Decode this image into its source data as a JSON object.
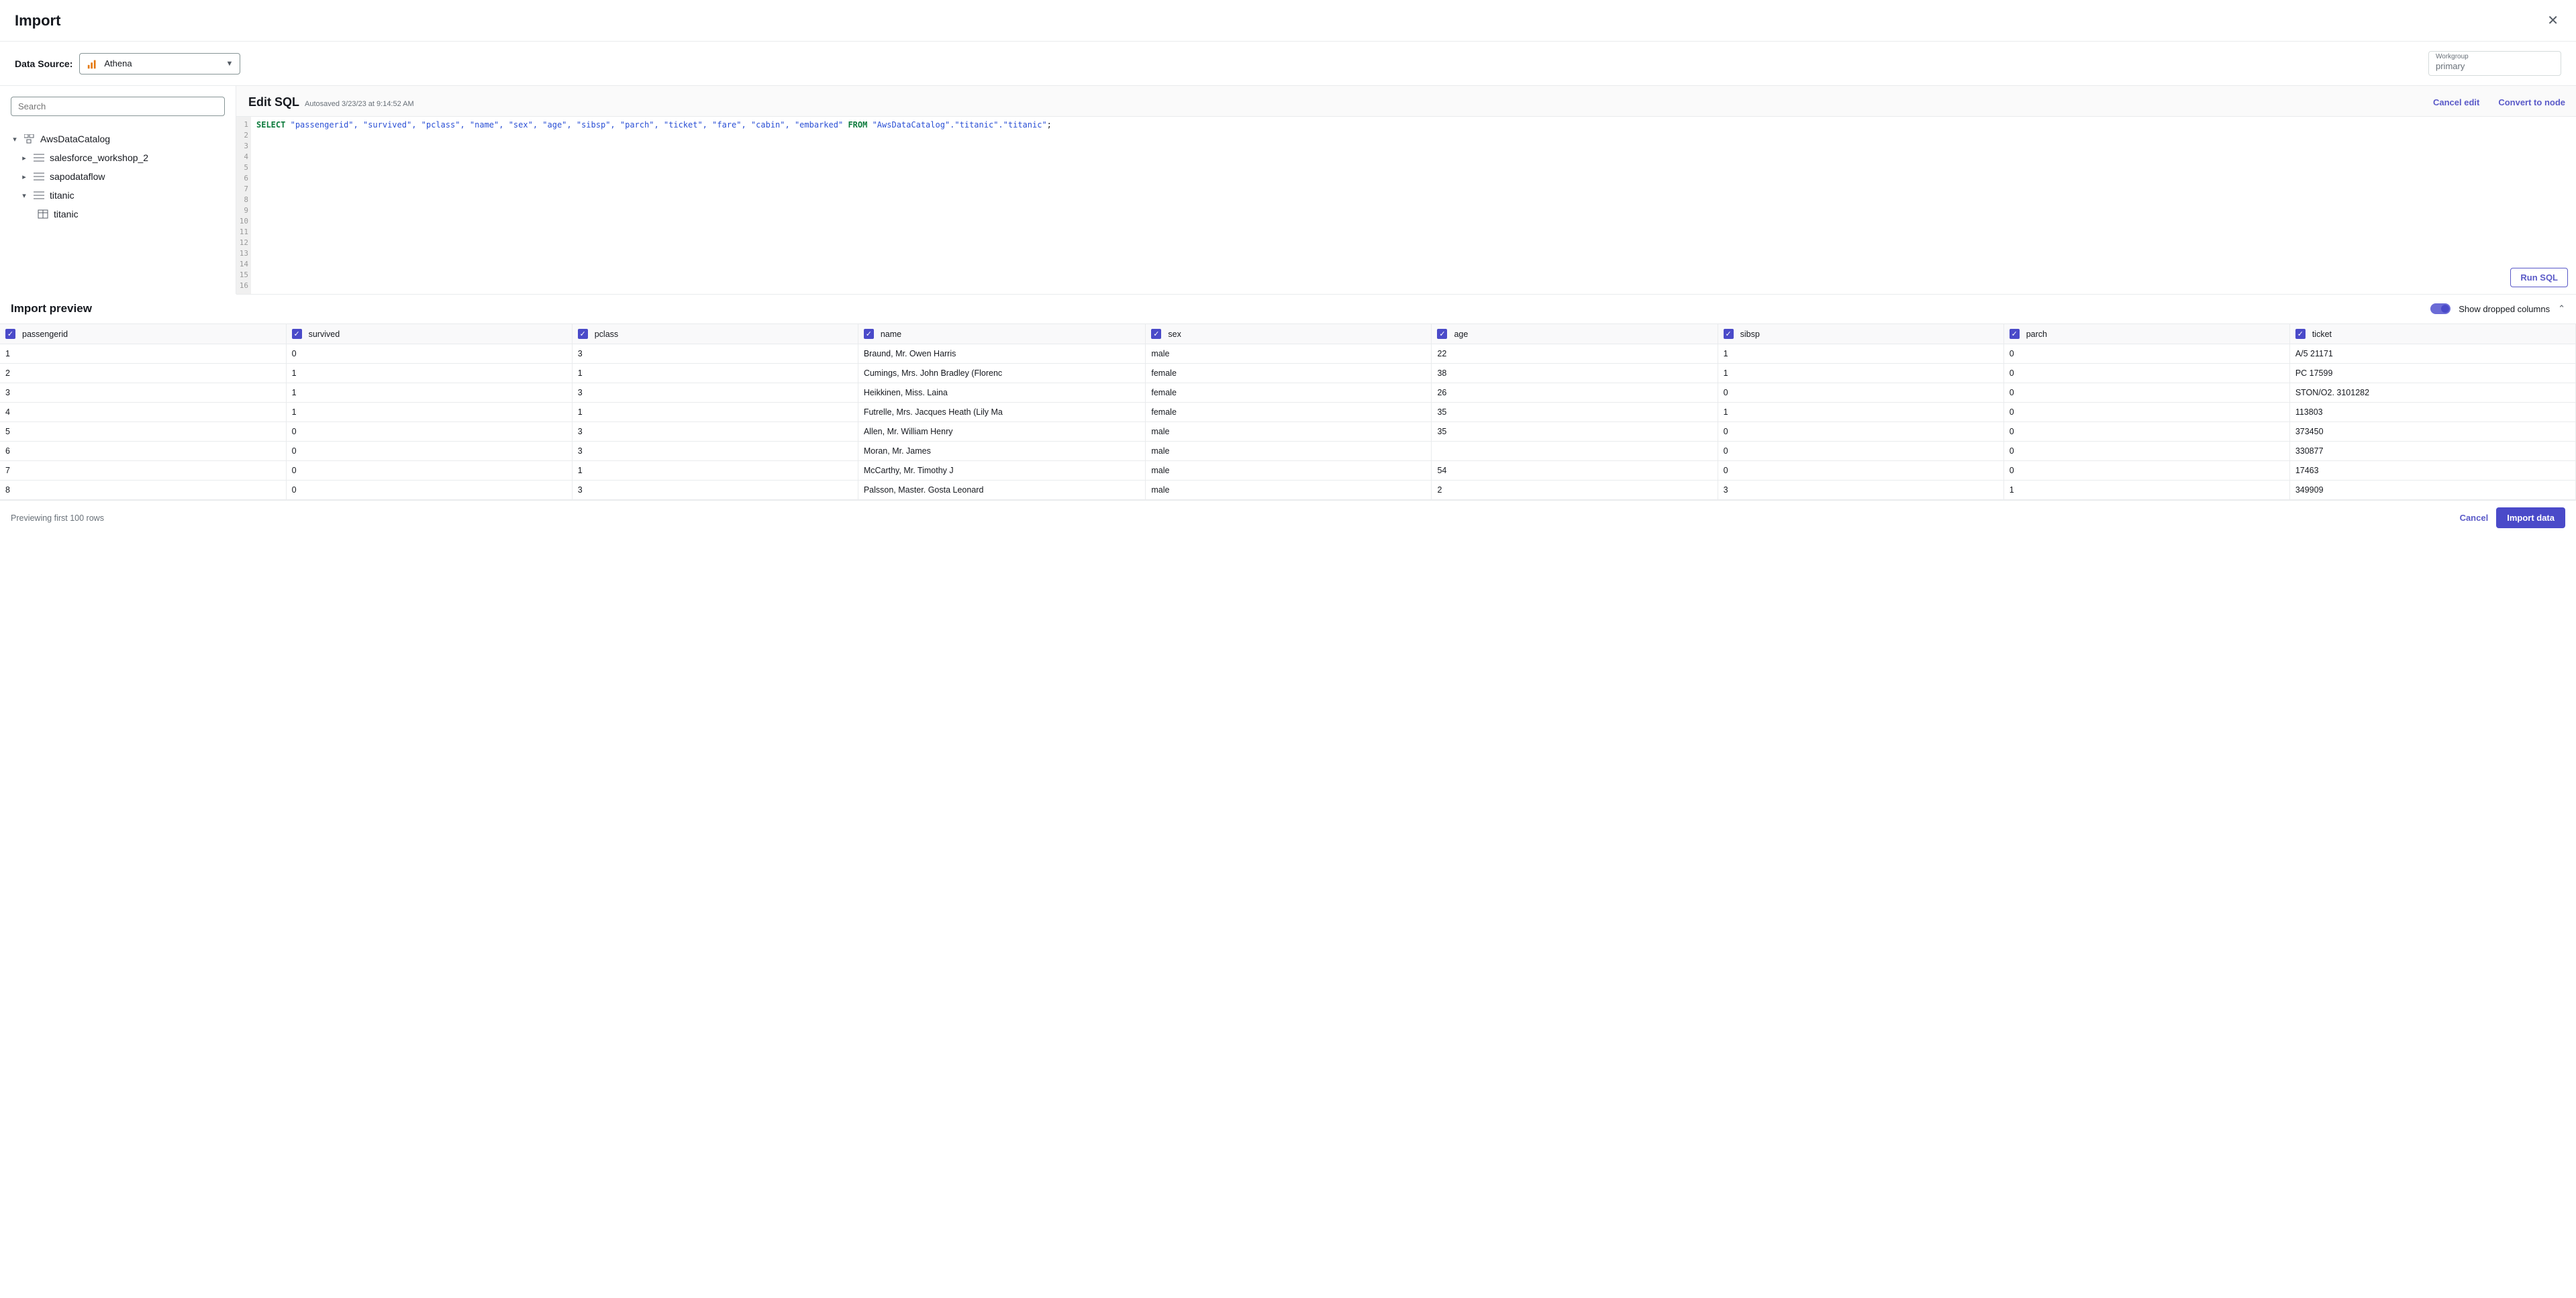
{
  "header": {
    "title": "Import"
  },
  "datasource": {
    "label": "Data Source:",
    "selected": "Athena"
  },
  "workgroup": {
    "label": "Workgroup",
    "value": "primary"
  },
  "search": {
    "placeholder": "Search"
  },
  "tree": {
    "catalog": "AwsDataCatalog",
    "db0": "salesforce_workshop_2",
    "db1": "sapodataflow",
    "db2": "titanic",
    "table0": "titanic"
  },
  "sql": {
    "title": "Edit SQL",
    "autosaved": "Autosaved 3/23/23 at 9:14:52 AM",
    "cancel_edit": "Cancel edit",
    "convert_node": "Convert to node",
    "run": "Run SQL",
    "select_kw": "SELECT",
    "from_kw": "FROM",
    "cols_line": "\"passengerid\", \"survived\", \"pclass\", \"name\", \"sex\", \"age\", \"sibsp\", \"parch\", \"ticket\", \"fare\", \"cabin\", \"embarked\"",
    "from_target": "\"AwsDataCatalog\".\"titanic\".\"titanic\"",
    "semicolon": ";"
  },
  "preview": {
    "title": "Import preview",
    "show_dropped": "Show dropped columns"
  },
  "columns": [
    "passengerid",
    "survived",
    "pclass",
    "name",
    "sex",
    "age",
    "sibsp",
    "parch",
    "ticket"
  ],
  "rows": [
    {
      "passengerid": "1",
      "survived": "0",
      "pclass": "3",
      "name": "Braund, Mr. Owen Harris",
      "sex": "male",
      "age": "22",
      "sibsp": "1",
      "parch": "0",
      "ticket": "A/5 21171"
    },
    {
      "passengerid": "2",
      "survived": "1",
      "pclass": "1",
      "name": "Cumings, Mrs. John Bradley (Florenc",
      "sex": "female",
      "age": "38",
      "sibsp": "1",
      "parch": "0",
      "ticket": "PC 17599"
    },
    {
      "passengerid": "3",
      "survived": "1",
      "pclass": "3",
      "name": "Heikkinen, Miss. Laina",
      "sex": "female",
      "age": "26",
      "sibsp": "0",
      "parch": "0",
      "ticket": "STON/O2. 3101282"
    },
    {
      "passengerid": "4",
      "survived": "1",
      "pclass": "1",
      "name": "Futrelle, Mrs. Jacques Heath (Lily Ma",
      "sex": "female",
      "age": "35",
      "sibsp": "1",
      "parch": "0",
      "ticket": "113803"
    },
    {
      "passengerid": "5",
      "survived": "0",
      "pclass": "3",
      "name": "Allen, Mr. William Henry",
      "sex": "male",
      "age": "35",
      "sibsp": "0",
      "parch": "0",
      "ticket": "373450"
    },
    {
      "passengerid": "6",
      "survived": "0",
      "pclass": "3",
      "name": "Moran, Mr. James",
      "sex": "male",
      "age": "",
      "sibsp": "0",
      "parch": "0",
      "ticket": "330877"
    },
    {
      "passengerid": "7",
      "survived": "0",
      "pclass": "1",
      "name": "McCarthy, Mr. Timothy J",
      "sex": "male",
      "age": "54",
      "sibsp": "0",
      "parch": "0",
      "ticket": "17463"
    },
    {
      "passengerid": "8",
      "survived": "0",
      "pclass": "3",
      "name": "Palsson, Master. Gosta Leonard",
      "sex": "male",
      "age": "2",
      "sibsp": "3",
      "parch": "1",
      "ticket": "349909"
    }
  ],
  "footer": {
    "preview_note": "Previewing first 100 rows",
    "cancel": "Cancel",
    "import": "Import data"
  }
}
